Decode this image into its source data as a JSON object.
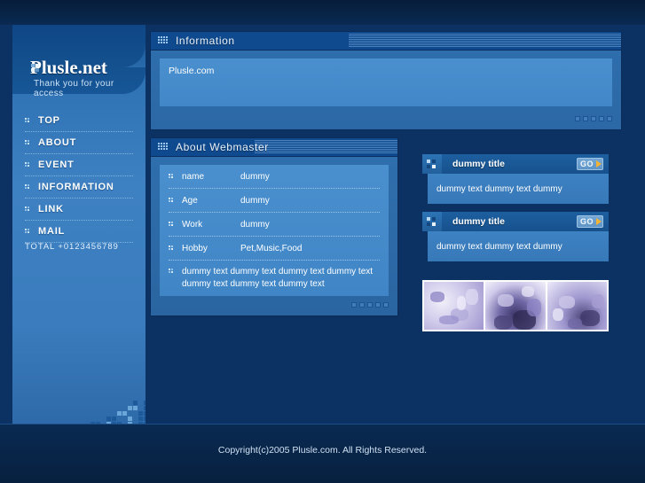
{
  "site": {
    "logo_text": "Plusle.net",
    "tagline": "Thank you for your access",
    "counter": "TOTAL +0123456789"
  },
  "sidebar": {
    "items": [
      {
        "label": "TOP"
      },
      {
        "label": "ABOUT"
      },
      {
        "label": "EVENT"
      },
      {
        "label": "INFORMATION"
      },
      {
        "label": "LINK"
      },
      {
        "label": "MAIL"
      }
    ]
  },
  "information": {
    "title": "Information",
    "body_text": "Plusle.com"
  },
  "about": {
    "title": "About Webmaster",
    "rows": [
      {
        "key": "name",
        "value": "dummy"
      },
      {
        "key": "Age",
        "value": "dummy"
      },
      {
        "key": "Work",
        "value": "dummy"
      },
      {
        "key": "Hobby",
        "value": "Pet,Music,Food"
      }
    ],
    "note": "dummy text dummy text dummy text dummy text dummy text dummy text dummy text"
  },
  "news": {
    "cards": [
      {
        "title": "dummy title",
        "text": "dummy text dummy text dummy",
        "go_label": "GO"
      },
      {
        "title": "dummy title",
        "text": "dummy text dummy text dummy",
        "go_label": "GO"
      }
    ]
  },
  "footer": {
    "copyright": "Copyright(c)2005 Plusle.com. All Rights Reserved."
  },
  "colors": {
    "page_bg": "#0c3163",
    "sidebar_top": "#14518f",
    "sidebar_mid": "#3e81c2",
    "panel_header": "#104a8e",
    "panel_body": "#4a8fce",
    "accent_orange": "#f5b333",
    "text_light": "#ffffff"
  }
}
